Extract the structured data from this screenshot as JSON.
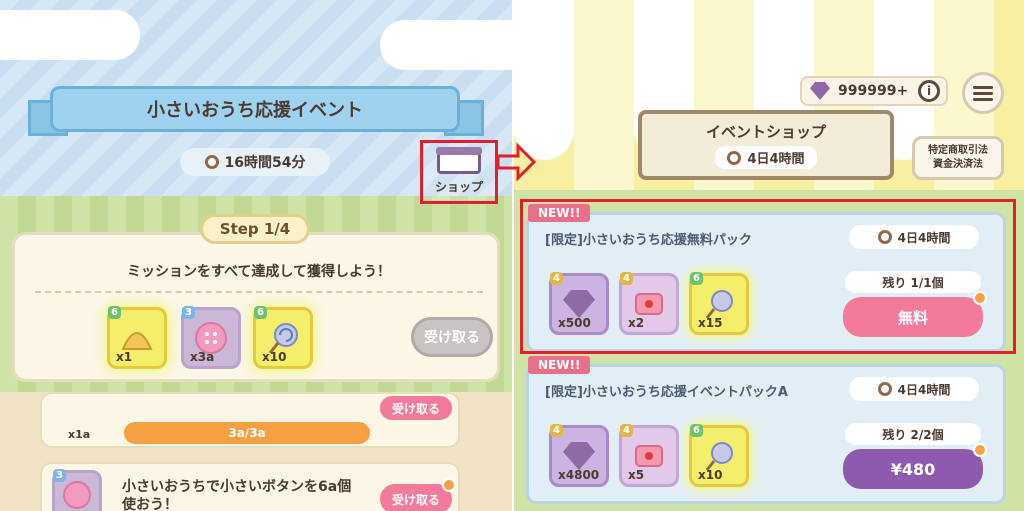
{
  "left": {
    "event_title": "小さいおうち応援イベント",
    "event_timer": "16時間54分",
    "shop_label": "ショップ",
    "step_label": "Step 1/4",
    "mission_text": "ミッションをすべて達成して獲得しよう！",
    "rewards": [
      {
        "level": "6",
        "qty": "x1",
        "icon": "shell-icon"
      },
      {
        "level": "3",
        "qty": "x3a",
        "icon": "button-icon"
      },
      {
        "level": "6",
        "qty": "x10",
        "icon": "lollipop-icon"
      }
    ],
    "receive_label": "受け取る",
    "list_item_1": {
      "qty": "x1a",
      "progress": "3a/3a",
      "button_label": "受け取る"
    },
    "list_item_2": {
      "level": "3",
      "text": "小さいおうちで小さいボタンを6a個使おう！",
      "button_label": "受け取る"
    }
  },
  "right": {
    "gem_count": "999999+",
    "info_label": "i",
    "shop_title": "イベントショップ",
    "shop_timer": "4日4時間",
    "legal_label_1": "特定商取引法",
    "legal_label_2": "資金決済法",
    "packs": [
      {
        "new_tag": "NEW!!",
        "title": "[限定]小さいおうち応援無料パック",
        "timer": "4日4時間",
        "items": [
          {
            "level": "4",
            "qty": "x500",
            "icon": "gem-icon"
          },
          {
            "level": "4",
            "qty": "x2",
            "icon": "ticket-icon"
          },
          {
            "level": "6",
            "qty": "x15",
            "icon": "lollipop-icon"
          }
        ],
        "remaining": "残り 1/1個",
        "price": "無料"
      },
      {
        "new_tag": "NEW!!",
        "title": "[限定]小さいおうち応援イベントパックA",
        "timer": "4日4時間",
        "items": [
          {
            "level": "4",
            "qty": "x4800",
            "icon": "gem-icon"
          },
          {
            "level": "4",
            "qty": "x5",
            "icon": "ticket-icon"
          },
          {
            "level": "6",
            "qty": "x10",
            "icon": "lollipop-icon"
          }
        ],
        "remaining": "残り 2/2個",
        "price": "¥480"
      }
    ]
  },
  "colors": {
    "highlight": "#e0202a",
    "free_button": "#f27b9b",
    "paid_button": "#8e5ab0"
  }
}
